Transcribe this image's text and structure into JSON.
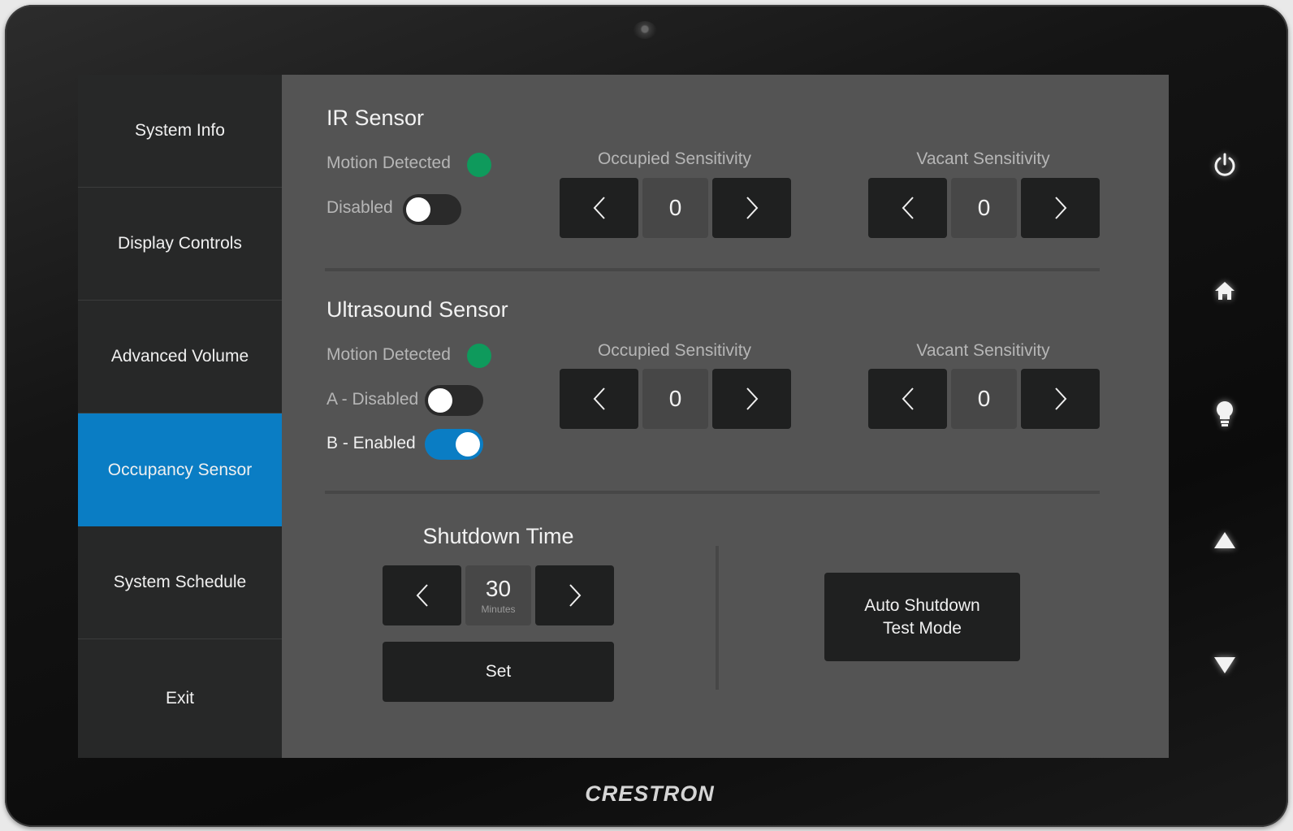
{
  "device": {
    "brand": "CRESTRON",
    "hardware_buttons": [
      "power-icon",
      "home-icon",
      "lightbulb-icon",
      "up-arrow-icon",
      "down-arrow-icon"
    ]
  },
  "sidebar": {
    "items": [
      {
        "label": "System Info",
        "active": false
      },
      {
        "label": "Display Controls",
        "active": false
      },
      {
        "label": "Advanced Volume",
        "active": false
      },
      {
        "label": "Occupancy Sensor",
        "active": true
      },
      {
        "label": "System Schedule",
        "active": false
      },
      {
        "label": "Exit",
        "active": false
      }
    ]
  },
  "ir_sensor": {
    "title": "IR Sensor",
    "motion_label": "Motion Detected",
    "motion_color": "#0e9a5c",
    "toggle": {
      "label": "Disabled",
      "on": false
    },
    "occupied": {
      "label": "Occupied Sensitivity",
      "value": "0"
    },
    "vacant": {
      "label": "Vacant Sensitivity",
      "value": "0"
    }
  },
  "ultrasound_sensor": {
    "title": "Ultrasound Sensor",
    "motion_label": "Motion Detected",
    "motion_color": "#0e9a5c",
    "toggle_a": {
      "label": "A - Disabled",
      "on": false
    },
    "toggle_b": {
      "label": "B - Enabled",
      "on": true
    },
    "occupied": {
      "label": "Occupied Sensitivity",
      "value": "0"
    },
    "vacant": {
      "label": "Vacant Sensitivity",
      "value": "0"
    }
  },
  "shutdown": {
    "title": "Shutdown Time",
    "value": "30",
    "unit": "Minutes",
    "set_label": "Set",
    "test_mode_line1": "Auto Shutdown",
    "test_mode_line2": "Test Mode"
  },
  "colors": {
    "accent": "#0a7dc4",
    "panel": "#545454",
    "sidebar": "#272828",
    "button": "#1f2020"
  }
}
